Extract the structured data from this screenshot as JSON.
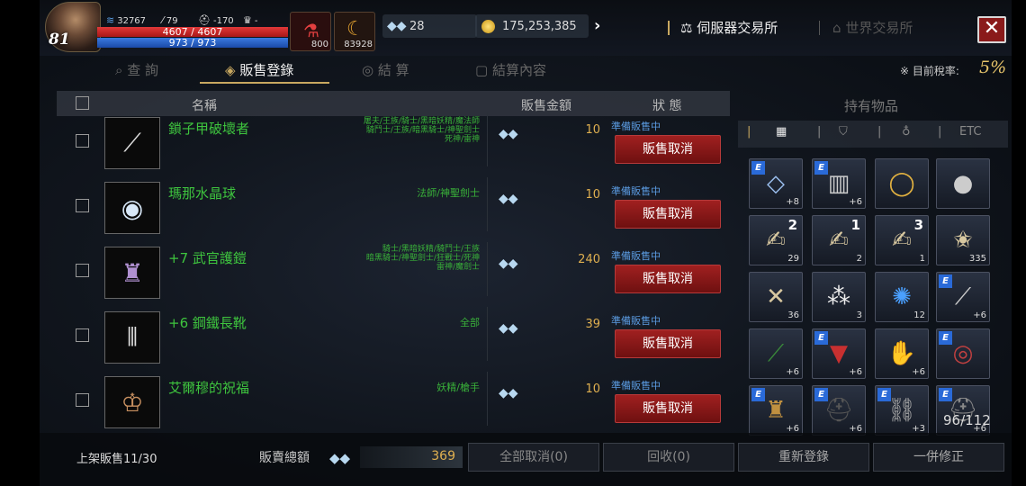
{
  "player": {
    "level": "81",
    "power": "32767",
    "attack": "79",
    "defense": "-170",
    "trophy": "-",
    "hp": "4607 / 4607",
    "mp": "973 / 973",
    "potion_count": "800",
    "item_count": "83928"
  },
  "currency": {
    "crystals": "28",
    "gold": "175,253,385"
  },
  "exchange": {
    "server": "伺服器交易所",
    "world": "世界交易所"
  },
  "tabs": [
    {
      "label": "查 詢",
      "icon": "search-icon"
    },
    {
      "label": "販售登錄",
      "icon": "tag-icon"
    },
    {
      "label": "結 算",
      "icon": "coins-icon"
    },
    {
      "label": "結算內容",
      "icon": "document-icon"
    }
  ],
  "tax": {
    "label": "※ 目前稅率:",
    "value": "5%"
  },
  "table": {
    "headers": {
      "name": "名稱",
      "price": "販售金額",
      "status": "狀 態"
    },
    "rows": [
      {
        "name": "鎖子甲破壞者",
        "classes": "屠夫/王族/騎士/黑暗妖精/魔法師\n騎鬥士/王族/暗黑騎士/神聖劍士\n死神/雷神",
        "price": "10",
        "status": "準備販售中",
        "cancel": "販售取消",
        "icon": "sword-icon"
      },
      {
        "name": "瑪那水晶球",
        "classes": "法師/神聖劍士",
        "price": "10",
        "status": "準備販售中",
        "cancel": "販售取消",
        "icon": "crystal-orb-icon"
      },
      {
        "name": "+7 武官護鎧",
        "classes": "騎士/黑暗妖精/騎鬥士/王族\n暗黑騎士/神聖劍士/狂戰士/死神\n雷神/魔劍士",
        "price": "240",
        "status": "準備販售中",
        "cancel": "販售取消",
        "icon": "armor-icon"
      },
      {
        "name": "+6 鋼鐵長靴",
        "classes": "全部",
        "price": "39",
        "status": "準備販售中",
        "cancel": "販售取消",
        "icon": "boots-icon"
      },
      {
        "name": "艾爾穆的祝福",
        "classes": "妖精/槍手",
        "price": "10",
        "status": "準備販售中",
        "cancel": "販售取消",
        "icon": "amulet-icon"
      }
    ]
  },
  "inventory": {
    "title": "持有物品",
    "tabs": [
      "ETC"
    ],
    "capacity": "96/112",
    "slots": [
      {
        "icon": "crystal-ring-icon",
        "enchant": true,
        "count": "+8"
      },
      {
        "icon": "greaves-icon",
        "enchant": true,
        "count": "+6"
      },
      {
        "icon": "gold-ring-icon",
        "enchant": false,
        "count": ""
      },
      {
        "icon": "silver-orb-icon",
        "enchant": false,
        "count": ""
      },
      {
        "icon": "scroll-icon",
        "enchant": false,
        "count": "29",
        "num": "2"
      },
      {
        "icon": "scroll-icon",
        "enchant": false,
        "count": "2",
        "num": "1"
      },
      {
        "icon": "scroll-icon",
        "enchant": false,
        "count": "1",
        "num": "3"
      },
      {
        "icon": "scroll-star-icon",
        "enchant": false,
        "count": "335"
      },
      {
        "icon": "scroll-cross-icon",
        "enchant": false,
        "count": "36"
      },
      {
        "icon": "gems-icon",
        "enchant": false,
        "count": "3"
      },
      {
        "icon": "blue-orb-icon",
        "enchant": false,
        "count": "12"
      },
      {
        "icon": "dagger-icon",
        "enchant": true,
        "count": "+6"
      },
      {
        "icon": "green-sword-icon",
        "enchant": false,
        "count": "+6"
      },
      {
        "icon": "red-cloak-icon",
        "enchant": true,
        "count": "+6"
      },
      {
        "icon": "gauntlet-icon",
        "enchant": false,
        "count": "+6"
      },
      {
        "icon": "red-bracelet-icon",
        "enchant": true,
        "count": ""
      },
      {
        "icon": "gold-armor-icon",
        "enchant": true,
        "count": "+6"
      },
      {
        "icon": "black-helm-icon",
        "enchant": true,
        "count": "+6"
      },
      {
        "icon": "chain-icon",
        "enchant": true,
        "count": "+3"
      },
      {
        "icon": "gray-helm-icon",
        "enchant": true,
        "count": "+6"
      }
    ]
  },
  "footer": {
    "listed": "上架販售11/30",
    "total_label": "販賣總額",
    "total_value": "369",
    "cancel_all": "全部取消(0)",
    "reclaim": "回收(0)",
    "reregister": "重新登錄",
    "edit_all": "一併修正"
  },
  "colors": {
    "accent": "#c8a860",
    "item_name": "#3ec43e",
    "price": "#e0b050",
    "status": "#5a9ae0",
    "cancel_btn": "#8a1a1a"
  }
}
